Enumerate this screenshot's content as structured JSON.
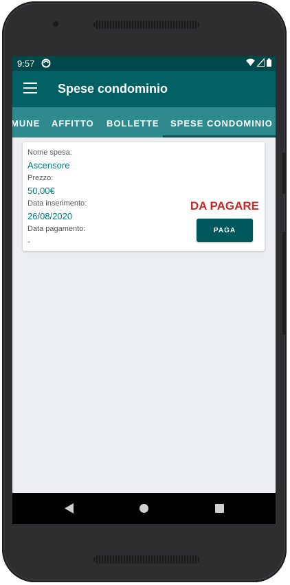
{
  "status_bar": {
    "time": "9:57",
    "icons": [
      "app-notification-icon",
      "wifi-icon",
      "signal-icon",
      "battery-icon"
    ]
  },
  "app_bar": {
    "title": "Spese condominio",
    "menu_icon": "hamburger-menu-icon"
  },
  "tabs": [
    {
      "label": "MUNE",
      "active": false
    },
    {
      "label": "AFFITTO",
      "active": false
    },
    {
      "label": "BOLLETTE",
      "active": false
    },
    {
      "label": "SPESE CONDOMINIO",
      "active": true
    }
  ],
  "expense_card": {
    "name_label": "Nome spesa:",
    "name_value": "Ascensore",
    "price_label": "Prezzo:",
    "price_value": "50,00€",
    "insert_date_label": "Data inserimento:",
    "insert_date_value": "26/08/2020",
    "payment_date_label": "Data pagamento:",
    "payment_date_value": "-",
    "status": "DA PAGARE",
    "pay_button_label": "PAGA"
  },
  "nav_bar": {
    "icons": [
      "back-icon",
      "home-icon",
      "recents-icon"
    ]
  },
  "colors": {
    "primary": "#006064",
    "primary_dark": "#00494a",
    "tab_background": "#2e8a8d",
    "accent_text": "#00797c",
    "status_unpaid": "#c62828",
    "button": "#00585c",
    "screen_background": "#eceff1"
  }
}
